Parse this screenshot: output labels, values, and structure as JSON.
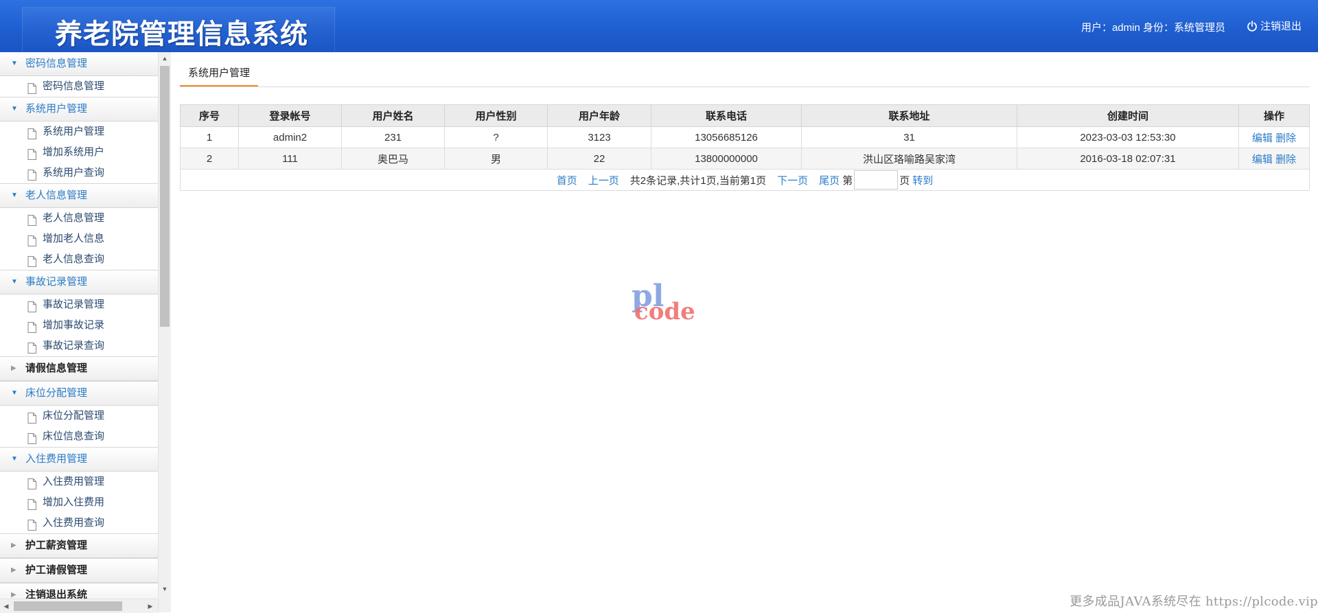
{
  "header": {
    "title": "养老院管理信息系统",
    "user_info": "用户：admin 身份：系统管理员",
    "logout_label": "注销退出"
  },
  "sidebar": {
    "groups": [
      {
        "label": "密码信息管理",
        "expanded": true,
        "items": [
          "密码信息管理"
        ]
      },
      {
        "label": "系统用户管理",
        "expanded": true,
        "items": [
          "系统用户管理",
          "增加系统用户",
          "系统用户查询"
        ]
      },
      {
        "label": "老人信息管理",
        "expanded": true,
        "items": [
          "老人信息管理",
          "增加老人信息",
          "老人信息查询"
        ]
      },
      {
        "label": "事故记录管理",
        "expanded": true,
        "items": [
          "事故记录管理",
          "增加事故记录",
          "事故记录查询"
        ]
      },
      {
        "label": "请假信息管理",
        "expanded": false,
        "items": []
      },
      {
        "label": "床位分配管理",
        "expanded": true,
        "items": [
          "床位分配管理",
          "床位信息查询"
        ]
      },
      {
        "label": "入住费用管理",
        "expanded": true,
        "items": [
          "入住费用管理",
          "增加入住费用",
          "入住费用查询"
        ]
      },
      {
        "label": "护工薪资管理",
        "expanded": false,
        "items": []
      },
      {
        "label": "护工请假管理",
        "expanded": false,
        "items": []
      },
      {
        "label": "注销退出系统",
        "expanded": false,
        "items": []
      }
    ]
  },
  "main": {
    "tab_label": "系统用户管理",
    "table": {
      "columns": [
        "序号",
        "登录帐号",
        "用户姓名",
        "用户性别",
        "用户年龄",
        "联系电话",
        "联系地址",
        "创建时间",
        "操作"
      ],
      "rows": [
        [
          "1",
          "admin2",
          "231",
          "?",
          "3123",
          "13056685126",
          "31",
          "2023-03-03 12:53:30"
        ],
        [
          "2",
          "111",
          "奥巴马",
          "男",
          "22",
          "13800000000",
          "洪山区珞喻路吴家湾",
          "2016-03-18 02:07:31"
        ]
      ],
      "edit_label": "编辑",
      "delete_label": "删除"
    },
    "pager": {
      "first": "首页",
      "prev": "上一页",
      "summary": "共2条记录,共计1页,当前第1页",
      "next": "下一页",
      "last": "尾页",
      "page_prefix": "第",
      "page_value": "",
      "page_suffix": "页",
      "go": "转到"
    }
  },
  "watermark": {
    "logo_top": "pl",
    "logo_bottom": "code",
    "footer": "更多成品JAVA系统尽在 https://plcode.vip"
  },
  "colors": {
    "header_blue": "#1f5ed1",
    "link_blue": "#2a7cc7",
    "tab_accent": "#f08a24"
  }
}
